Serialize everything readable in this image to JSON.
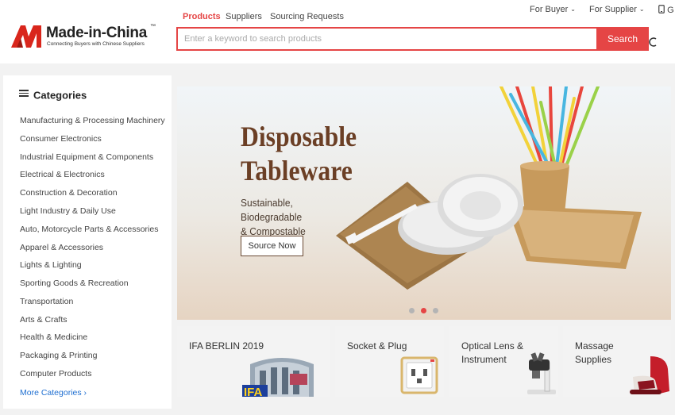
{
  "header": {
    "logo": {
      "name": "Made-in-China",
      "tm": "™",
      "tagline": "Connecting Buyers with Chinese Suppliers"
    },
    "search_tabs": [
      {
        "label": "Products",
        "active": true
      },
      {
        "label": "Suppliers",
        "active": false
      },
      {
        "label": "Sourcing Requests",
        "active": false
      }
    ],
    "search": {
      "placeholder": "Enter a keyword to search products",
      "button_label": "Search"
    },
    "top_nav": [
      {
        "label": "For Buyer",
        "icon": "chevron-down-icon"
      },
      {
        "label": "For Supplier",
        "icon": "chevron-down-icon"
      },
      {
        "label": "G",
        "icon": "phone-icon"
      }
    ]
  },
  "categories": {
    "title": "Categories",
    "items": [
      "Manufacturing & Processing Machinery",
      "Consumer Electronics",
      "Industrial Equipment & Components",
      "Electrical & Electronics",
      "Construction & Decoration",
      "Light Industry & Daily Use",
      "Auto, Motorcycle Parts & Accessories",
      "Apparel & Accessories",
      "Lights & Lighting",
      "Sporting Goods & Recreation",
      "Transportation",
      "Arts & Crafts",
      "Health & Medicine",
      "Packaging & Printing",
      "Computer Products"
    ],
    "more_label": "More Categories ›"
  },
  "banner": {
    "title_line1": "Disposable",
    "title_line2": "Tableware",
    "subtitle_line1": "Sustainable, Biodegradable",
    "subtitle_line2": "& Compostable",
    "button_label": "Source Now",
    "slide_count": 3,
    "active_slide": 2
  },
  "tiles": [
    {
      "label": "IFA BERLIN 2019",
      "art_text": "IFA"
    },
    {
      "label": "Socket & Plug"
    },
    {
      "label": "Optical Lens & Instrument"
    },
    {
      "label": "Massage Supplies"
    }
  ],
  "colors": {
    "accent": "#e54545",
    "brand_dark": "#222222",
    "link": "#1f6fd1",
    "banner_title": "#6b3f25"
  }
}
